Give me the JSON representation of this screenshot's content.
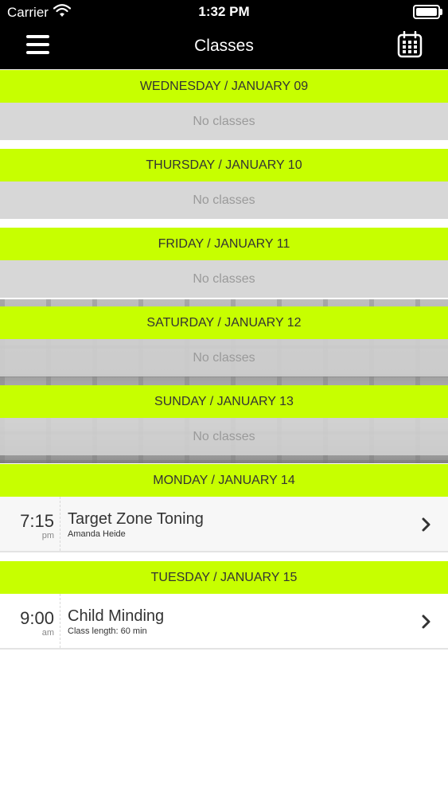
{
  "status_bar": {
    "carrier": "Carrier",
    "time": "1:32 PM"
  },
  "header": {
    "title": "Classes"
  },
  "icons": {
    "menu": "hamburger-menu-icon",
    "calendar": "calendar-icon",
    "chevron": "chevron-right-icon",
    "wifi": "wifi-icon",
    "battery": "battery-icon"
  },
  "colors": {
    "accent": "#c7ff00",
    "header_bg": "#000000"
  },
  "days": [
    {
      "header": "WEDNESDAY / JANUARY 09",
      "empty_text": "No classes"
    },
    {
      "header": "THURSDAY / JANUARY 10",
      "empty_text": "No classes"
    },
    {
      "header": "FRIDAY / JANUARY 11",
      "empty_text": "No classes"
    },
    {
      "header": "SATURDAY / JANUARY 12",
      "empty_text": "No classes"
    },
    {
      "header": "SUNDAY / JANUARY 13",
      "empty_text": "No classes"
    },
    {
      "header": "MONDAY / JANUARY 14",
      "classes": [
        {
          "time": "7:15",
          "ampm": "pm",
          "name": "Target Zone Toning",
          "subtitle": "Amanda Heide"
        }
      ]
    },
    {
      "header": "TUESDAY / JANUARY 15",
      "classes": [
        {
          "time": "9:00",
          "ampm": "am",
          "name": "Child Minding",
          "subtitle": "Class length: 60 min"
        }
      ]
    }
  ]
}
